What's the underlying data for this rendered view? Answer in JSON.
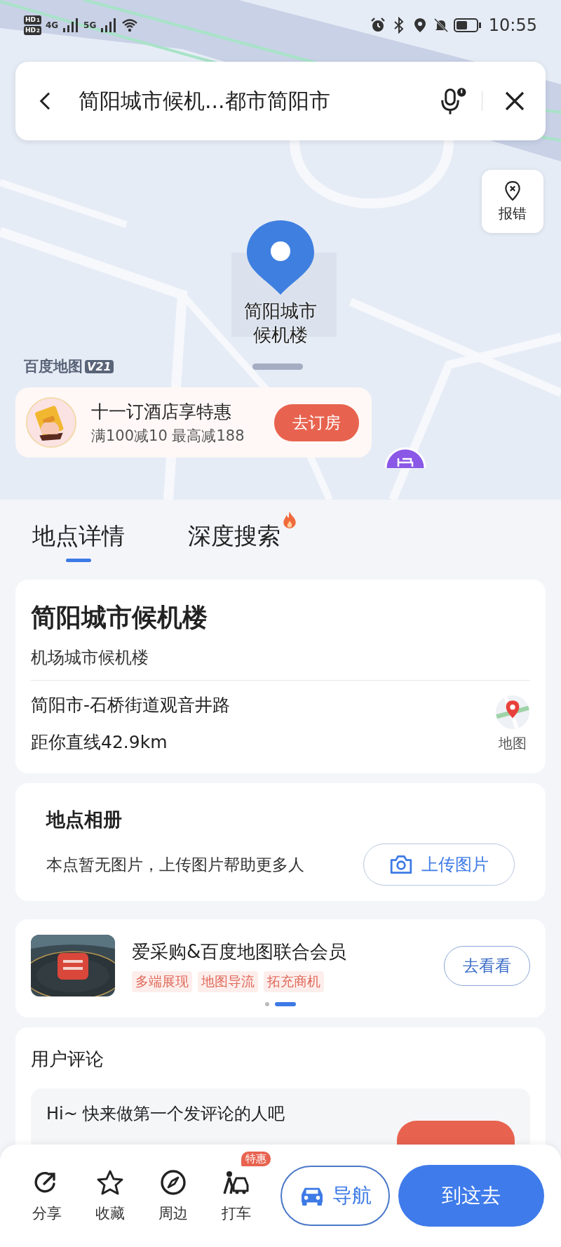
{
  "status_bar": {
    "sim_badges": [
      {
        "label": "HD",
        "slot": "1"
      },
      {
        "label": "HD",
        "slot": "2"
      }
    ],
    "networks": [
      "4G",
      "5G"
    ],
    "time": "10:55"
  },
  "search": {
    "value": "简阳城市候机...都市简阳市"
  },
  "report_button": "报错",
  "pin_label": "简阳城市候机楼",
  "logo": {
    "text": "百度地图",
    "version": "V21"
  },
  "promo": {
    "title": "十一订酒店享特惠",
    "subtitle": "满100减10 最高减188",
    "button": "去订房"
  },
  "tabs": [
    {
      "label": "地点详情",
      "selected": true,
      "hot": false
    },
    {
      "label": "深度搜索",
      "selected": false,
      "hot": true
    }
  ],
  "place": {
    "name": "简阳城市候机楼",
    "category": "机场城市候机楼",
    "address": "简阳市-石桥街道观音井路",
    "distance": "距你直线42.9km",
    "map_link": "地图"
  },
  "album": {
    "title": "地点相册",
    "text": "本点暂无图片，上传图片帮助更多人",
    "button": "上传图片"
  },
  "ad": {
    "title": "爱采购&百度地图联合会员",
    "tags": [
      "多端展现",
      "地图导流",
      "拓充商机"
    ],
    "button": "去看看",
    "pages": [
      {
        "selected": false
      },
      {
        "selected": true
      }
    ]
  },
  "reviews": {
    "title": "用户评论",
    "prompt": "Hi~ 快来做第一个发评论的人吧"
  },
  "bottom_bar": {
    "actions": [
      {
        "label": "分享",
        "kind": "share"
      },
      {
        "label": "收藏",
        "kind": "star"
      },
      {
        "label": "周边",
        "kind": "compass"
      },
      {
        "label": "打车",
        "kind": "taxi",
        "badge": "特惠"
      }
    ],
    "navigate": "导航",
    "go": "到这去"
  }
}
